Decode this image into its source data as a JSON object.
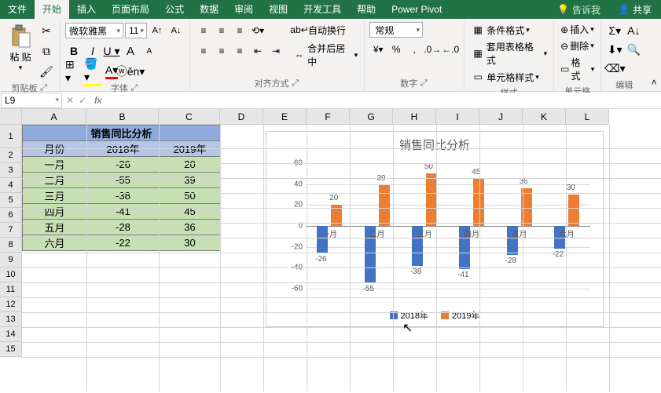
{
  "tabs": {
    "file": "文件",
    "home": "开始",
    "insert": "插入",
    "layout": "页面布局",
    "formulas": "公式",
    "data": "数据",
    "review": "审阅",
    "view": "视图",
    "dev": "开发工具",
    "help": "帮助",
    "pivot": "Power Pivot"
  },
  "tellme": "告诉我",
  "share": "共享",
  "ribbon": {
    "clipboard": {
      "paste": "粘 贴",
      "group": "剪贴板"
    },
    "font": {
      "name": "微软雅黑",
      "size": "11",
      "group": "字体"
    },
    "align": {
      "wrap": "自动换行",
      "merge": "合并后居中",
      "group": "对齐方式"
    },
    "number": {
      "format": "常规",
      "group": "数字"
    },
    "styles": {
      "cond": "条件格式",
      "table": "套用表格格式",
      "cell": "单元格样式",
      "group": "样式"
    },
    "cells": {
      "insert": "插入",
      "delete": "删除",
      "format": "格式",
      "group": "单元格"
    },
    "edit": {
      "group": "编辑"
    }
  },
  "namebox": "L9",
  "table": {
    "title": "销售同比分析",
    "headers": {
      "month": "月份",
      "y2018": "2018年",
      "y2019": "2019年"
    },
    "rows": [
      {
        "month": "一月",
        "v2018": "-26",
        "v2019": "20"
      },
      {
        "month": "二月",
        "v2018": "-55",
        "v2019": "39"
      },
      {
        "month": "三月",
        "v2018": "-38",
        "v2019": "50"
      },
      {
        "month": "四月",
        "v2018": "-41",
        "v2019": "45"
      },
      {
        "month": "五月",
        "v2018": "-28",
        "v2019": "36"
      },
      {
        "month": "六月",
        "v2018": "-22",
        "v2019": "30"
      }
    ]
  },
  "chart_data": {
    "type": "bar",
    "title": "销售同比分析",
    "categories": [
      "一月",
      "二月",
      "三月",
      "四月",
      "五月",
      "六月"
    ],
    "series": [
      {
        "name": "2018年",
        "values": [
          -26,
          -55,
          -38,
          -41,
          -28,
          -22
        ],
        "color": "#4472c4"
      },
      {
        "name": "2019年",
        "values": [
          20,
          39,
          50,
          45,
          36,
          30
        ],
        "color": "#ed7d31"
      }
    ],
    "ylim": [
      -60,
      60
    ],
    "yticks": [
      -60,
      -40,
      -20,
      0,
      20,
      40,
      60
    ]
  },
  "cols": [
    "A",
    "B",
    "C",
    "D",
    "E",
    "F",
    "G",
    "H",
    "I",
    "J",
    "K",
    "L"
  ]
}
